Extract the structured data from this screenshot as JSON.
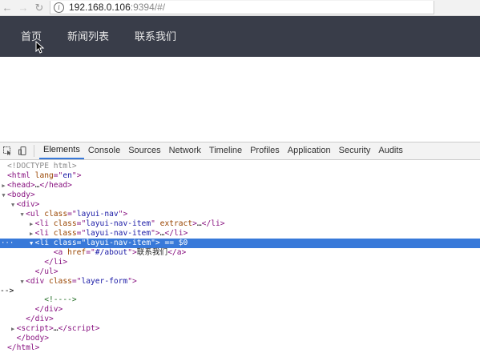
{
  "browser": {
    "url_host": "192.168.0.106",
    "url_rest": ":9394/#/"
  },
  "pagenav": {
    "items": [
      "首页",
      "新闻列表",
      "联系我们"
    ]
  },
  "devtools": {
    "tabs": [
      "Elements",
      "Console",
      "Sources",
      "Network",
      "Timeline",
      "Profiles",
      "Application",
      "Security",
      "Audits"
    ],
    "active_tab": "Elements",
    "tree": {
      "doctype": "<!DOCTYPE html>",
      "html_tag": "html",
      "lang_attr": "lang",
      "lang_val": "en",
      "head": "head",
      "head_close": "head",
      "body": "body",
      "div": "div",
      "ul": "ul",
      "class_attr": "class",
      "nav_class": "layui-nav",
      "li": "li",
      "nav_item_class": "layui-nav-item",
      "extract_attr": "extract",
      "selected_marker": " == $0",
      "a": "a",
      "href_attr": "href",
      "href_val": "#/about",
      "link_text": "联系我们",
      "layer_form_class": "layer-form",
      "comment": "<!---->",
      "script": "script",
      "ellipsis": "…"
    }
  },
  "colors": {
    "nav_bg": "#393d49",
    "selection": "#3879d9",
    "tag": "#881280",
    "attr_name": "#994500",
    "attr_value": "#1a1aa6"
  }
}
